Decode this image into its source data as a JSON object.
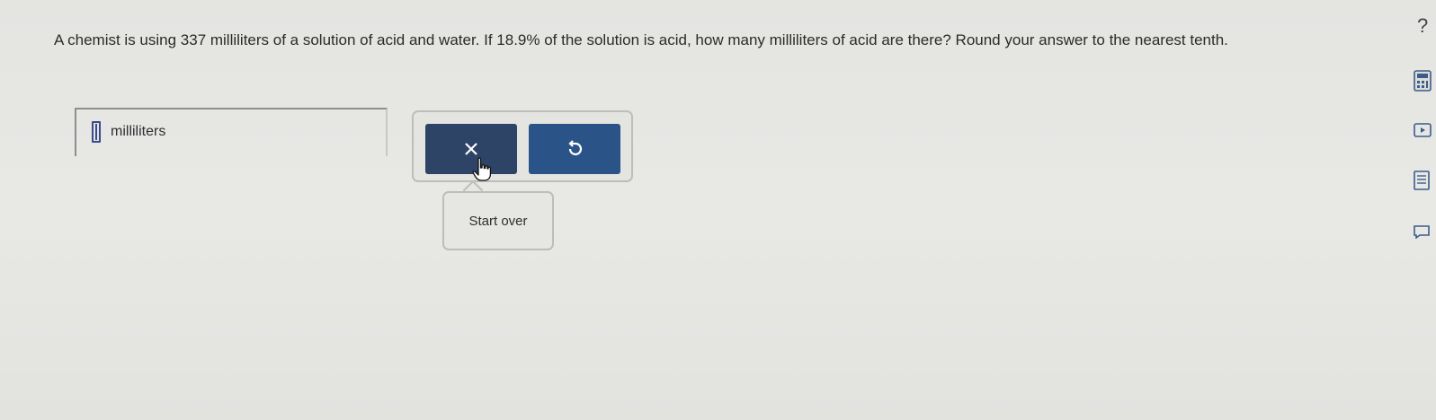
{
  "question": {
    "text": "A chemist is using 337 milliliters of a solution of acid and water. If 18.9% of the solution is acid, how many milliliters of acid are there? Round your answer to the nearest tenth."
  },
  "answer": {
    "value": "",
    "unit": "milliliters"
  },
  "buttons": {
    "clear_symbol": "×",
    "undo_symbol": "↺"
  },
  "tooltip": {
    "label": "Start over"
  },
  "sidebar": {
    "help_label": "?"
  }
}
